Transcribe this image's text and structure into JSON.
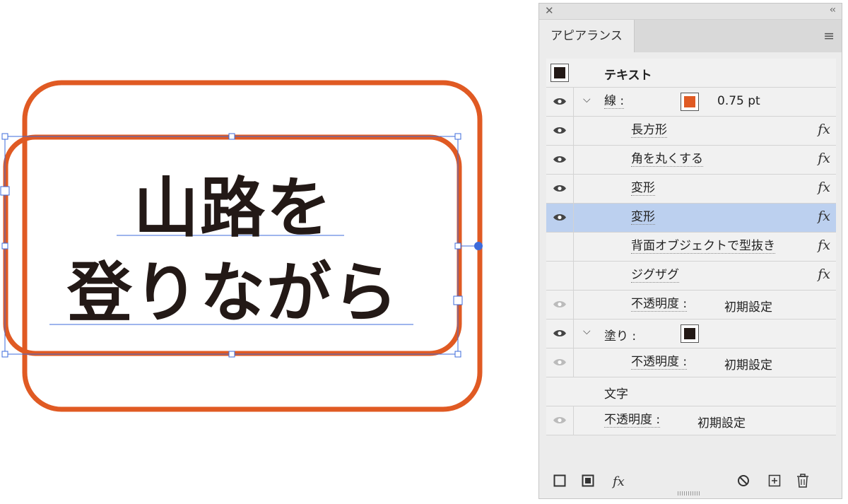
{
  "artwork": {
    "line1": "山路を",
    "line2": "登りながら",
    "stroke_color": "#e05a23",
    "text_color": "#231916",
    "selection_color": "#3d6bdb"
  },
  "panel": {
    "title": "アピアランス",
    "close_glyph": "✕",
    "collapse_glyph": "‹‹",
    "menu_glyph": "≡",
    "rows": [
      {
        "label": "テキスト",
        "bold": true
      },
      {
        "label": "線 :",
        "value": "0.75 pt",
        "swatch": "#e05a23"
      },
      {
        "label": "長方形",
        "fx": "fx"
      },
      {
        "label": "角を丸くする",
        "fx": "fx"
      },
      {
        "label": "変形",
        "fx": "fx"
      },
      {
        "label": "変形",
        "fx": "fx",
        "selected": true
      },
      {
        "label": "背面オブジェクトで型抜き",
        "fx": "fx"
      },
      {
        "label": "ジグザグ",
        "fx": "fx"
      },
      {
        "label": "不透明度 :",
        "value": "初期設定"
      },
      {
        "label": "塗り :",
        "swatch": "#231916"
      },
      {
        "label": "不透明度 :",
        "value": "初期設定"
      },
      {
        "label": "文字"
      },
      {
        "label": "不透明度 :",
        "value": "初期設定"
      }
    ],
    "bottom_fx": "fx"
  }
}
